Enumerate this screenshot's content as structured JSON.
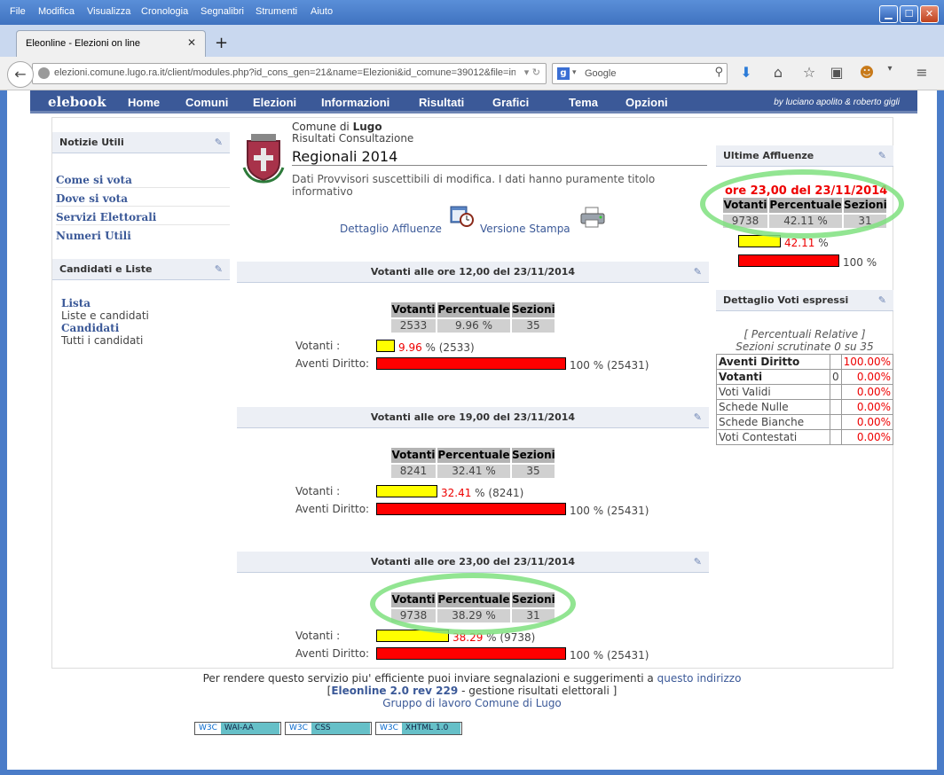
{
  "window": {
    "menu": [
      "File",
      "Modifica",
      "Visualizza",
      "Cronologia",
      "Segnalibri",
      "Strumenti",
      "Aiuto"
    ],
    "tab_title": "Eleonline - Elezioni on line",
    "url": "elezioni.comune.lugo.ra.it/client/modules.php?id_cons_gen=21&name=Elezioni&id_comune=39012&file=in",
    "search_engine": "Google",
    "search_placeholder": "Google"
  },
  "site": {
    "logo": "elebook",
    "nav": [
      "Home",
      "Comuni",
      "Elezioni",
      "Informazioni",
      "Risultati",
      "Grafici",
      "Tema",
      "Opzioni"
    ],
    "authors": "by luciano apolito & roberto gigli"
  },
  "left": {
    "notizie_title": "Notizie Utili",
    "notizie_links": [
      "Come si vota",
      "Dove si vota",
      "Servizi Elettorali",
      "Numeri Utili"
    ],
    "candidati_title": "Candidati e Liste",
    "lista_link": "Lista",
    "lista_desc": "Liste e candidati",
    "candidati_link": "Candidati",
    "candidati_desc": "Tutti i candidati"
  },
  "header": {
    "comune_prefix": "Comune di",
    "comune": "Lugo",
    "subtitle": "Risultati Consultazione",
    "title": "Regionali 2014",
    "notice": "Dati Provvisori suscettibili di modifica. I dati hanno puramente titolo informativo",
    "dettaglio": "Dettaglio Affluenze",
    "stampa": "Versione Stampa"
  },
  "table_headers": {
    "votanti": "Votanti",
    "percentuale": "Percentuale",
    "sezioni": "Sezioni"
  },
  "labels": {
    "votanti": "Votanti :",
    "aventi": "Aventi Diritto:"
  },
  "turnouts": [
    {
      "title": "Votanti alle ore 12,00 del 23/11/2014",
      "votanti": "2533",
      "percentuale": "9.96 %",
      "sezioni": "35",
      "pct": "9.96",
      "count": "(2533)",
      "fraction": 0.0996,
      "total_pct": "100 %",
      "total": "(25431)"
    },
    {
      "title": "Votanti alle ore 19,00 del 23/11/2014",
      "votanti": "8241",
      "percentuale": "32.41 %",
      "sezioni": "35",
      "pct": "32.41",
      "count": "(8241)",
      "fraction": 0.3241,
      "total_pct": "100 %",
      "total": "(25431)"
    },
    {
      "title": "Votanti alle ore 23,00 del 23/11/2014",
      "votanti": "9738",
      "percentuale": "38.29 %",
      "sezioni": "31",
      "pct": "38.29",
      "count": "(9738)",
      "fraction": 0.3829,
      "total_pct": "100 %",
      "total": "(25431)"
    }
  ],
  "right": {
    "affluenze_title": "Ultime Affluenze",
    "ore": "ore 23,00 del 23/11/2014",
    "votanti": "9738",
    "percentuale": "42.11 %",
    "sezioni": "31",
    "pct": "42.11",
    "pct_sign": "%",
    "fraction": 0.4211,
    "total": "100 %",
    "dettaglio_title": "Dettaglio Voti espressi",
    "percentuali": "[ Percentuali Relative ]",
    "sezioni_scrutinate": "Sezioni scrutinate 0 su 35",
    "rows": [
      {
        "label": "Aventi Diritto",
        "value": "",
        "pct": "100.00%",
        "bold": true
      },
      {
        "label": "Votanti",
        "value": "0",
        "pct": "0.00%",
        "bold": true
      },
      {
        "label": "Voti Validi",
        "value": "",
        "pct": "0.00%",
        "bold": false
      },
      {
        "label": "Schede Nulle",
        "value": "",
        "pct": "0.00%",
        "bold": false
      },
      {
        "label": "Schede Bianche",
        "value": "",
        "pct": "0.00%",
        "bold": false
      },
      {
        "label": "Voti Contestati",
        "value": "",
        "pct": "0.00%",
        "bold": false
      }
    ]
  },
  "footer": {
    "line1": "Per rendere questo servizio piu' efficiente puoi inviare segnalazioni e suggerimenti a",
    "line1_link": "questo indirizzo",
    "line2_open": "[",
    "line2_link": "Eleonline 2.0 rev 229",
    "line2_rest": "- gestione risultati elettorali ]",
    "line3": "Gruppo di lavoro Comune di Lugo",
    "badges": [
      {
        "a": "W3C",
        "b": "WAI-AA"
      },
      {
        "a": "W3C",
        "b": "CSS"
      },
      {
        "a": "W3C",
        "b": "XHTML 1.0"
      }
    ]
  },
  "colors": {
    "brand": "#3b5998",
    "highlight": "#7fe07f",
    "bar_yellow": "#ffff00",
    "bar_red": "#ff0000",
    "pct_red": "#e00000"
  },
  "icons": [
    "back-icon",
    "globe-icon",
    "reload-icon",
    "google-icon",
    "magnifier-icon",
    "download-icon",
    "home-icon",
    "star-icon",
    "clipboard-icon",
    "addon-icon",
    "menu-icon",
    "coat-of-arms-icon",
    "calendar-clock-icon",
    "printer-icon",
    "pencil-icon"
  ]
}
